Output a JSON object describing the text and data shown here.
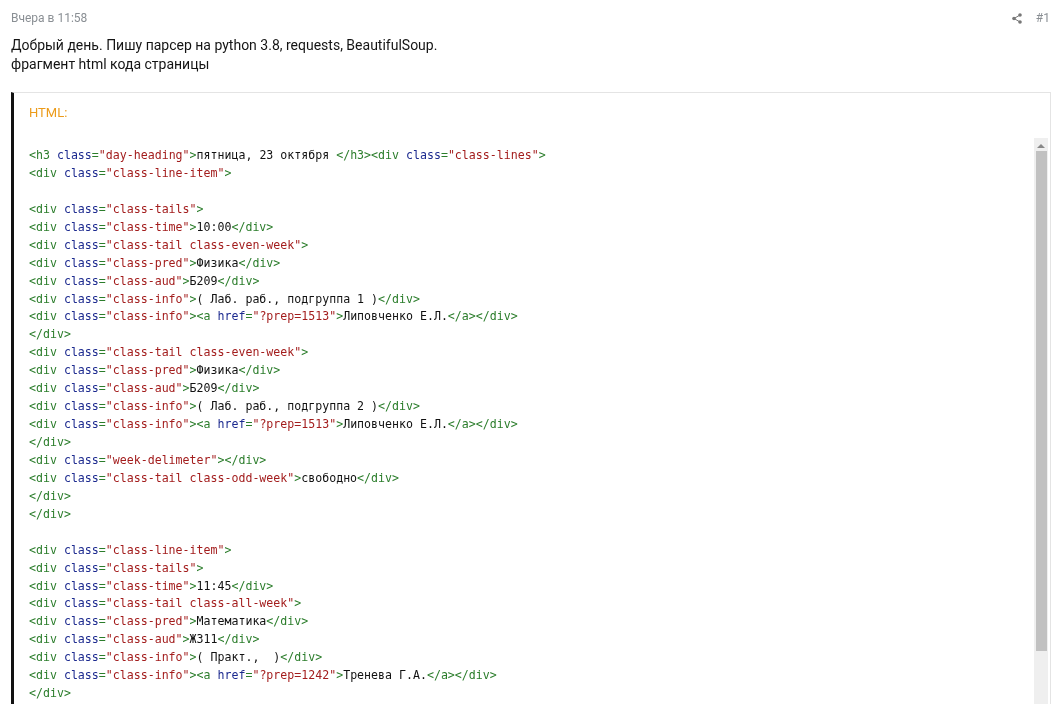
{
  "post": {
    "time": "Вчера в 11:58",
    "number": "#1",
    "body": [
      "Добрый день. Пишу парсер на python 3.8, requests, BeautifulSoup.",
      "фрагмент html кода страницы"
    ]
  },
  "code_block": {
    "language": "HTML:",
    "lines": [
      {
        "kind": "code",
        "tokens": [
          {
            "kind": "tag",
            "text": "<h3"
          },
          {
            "kind": "attr",
            "text": " class"
          },
          {
            "kind": "tag",
            "text": "="
          },
          {
            "kind": "value",
            "text": "\"day-heading\""
          },
          {
            "kind": "tag",
            "text": ">"
          },
          {
            "kind": "text",
            "text": "пятница, 23 октября "
          },
          {
            "kind": "tag",
            "text": "</h3><div"
          },
          {
            "kind": "attr",
            "text": " class"
          },
          {
            "kind": "tag",
            "text": "="
          },
          {
            "kind": "value",
            "text": "\"class-lines\""
          },
          {
            "kind": "tag",
            "text": ">"
          }
        ]
      },
      {
        "kind": "code",
        "tokens": [
          {
            "kind": "tag",
            "text": "<div"
          },
          {
            "kind": "attr",
            "text": " class"
          },
          {
            "kind": "tag",
            "text": "="
          },
          {
            "kind": "value",
            "text": "\"class-line-item\""
          },
          {
            "kind": "tag",
            "text": ">"
          }
        ]
      },
      {
        "kind": "blank"
      },
      {
        "kind": "code",
        "tokens": [
          {
            "kind": "tag",
            "text": "<div"
          },
          {
            "kind": "attr",
            "text": " class"
          },
          {
            "kind": "tag",
            "text": "="
          },
          {
            "kind": "value",
            "text": "\"class-tails\""
          },
          {
            "kind": "tag",
            "text": ">"
          }
        ]
      },
      {
        "kind": "code",
        "tokens": [
          {
            "kind": "tag",
            "text": "<div"
          },
          {
            "kind": "attr",
            "text": " class"
          },
          {
            "kind": "tag",
            "text": "="
          },
          {
            "kind": "value",
            "text": "\"class-time\""
          },
          {
            "kind": "tag",
            "text": ">"
          },
          {
            "kind": "text",
            "text": "10:00"
          },
          {
            "kind": "tag",
            "text": "</div>"
          }
        ]
      },
      {
        "kind": "code",
        "tokens": [
          {
            "kind": "tag",
            "text": "<div"
          },
          {
            "kind": "attr",
            "text": " class"
          },
          {
            "kind": "tag",
            "text": "="
          },
          {
            "kind": "value",
            "text": "\"class-tail class-even-week\""
          },
          {
            "kind": "tag",
            "text": ">"
          }
        ]
      },
      {
        "kind": "code",
        "tokens": [
          {
            "kind": "tag",
            "text": "<div"
          },
          {
            "kind": "attr",
            "text": " class"
          },
          {
            "kind": "tag",
            "text": "="
          },
          {
            "kind": "value",
            "text": "\"class-pred\""
          },
          {
            "kind": "tag",
            "text": ">"
          },
          {
            "kind": "text",
            "text": "Физика"
          },
          {
            "kind": "tag",
            "text": "</div>"
          }
        ]
      },
      {
        "kind": "code",
        "tokens": [
          {
            "kind": "tag",
            "text": "<div"
          },
          {
            "kind": "attr",
            "text": " class"
          },
          {
            "kind": "tag",
            "text": "="
          },
          {
            "kind": "value",
            "text": "\"class-aud\""
          },
          {
            "kind": "tag",
            "text": ">"
          },
          {
            "kind": "text",
            "text": "Б209"
          },
          {
            "kind": "tag",
            "text": "</div>"
          }
        ]
      },
      {
        "kind": "code",
        "tokens": [
          {
            "kind": "tag",
            "text": "<div"
          },
          {
            "kind": "attr",
            "text": " class"
          },
          {
            "kind": "tag",
            "text": "="
          },
          {
            "kind": "value",
            "text": "\"class-info\""
          },
          {
            "kind": "tag",
            "text": ">"
          },
          {
            "kind": "text",
            "text": "( Лаб. раб., подгруппа 1 )"
          },
          {
            "kind": "tag",
            "text": "</div>"
          }
        ]
      },
      {
        "kind": "code",
        "tokens": [
          {
            "kind": "tag",
            "text": "<div"
          },
          {
            "kind": "attr",
            "text": " class"
          },
          {
            "kind": "tag",
            "text": "="
          },
          {
            "kind": "value",
            "text": "\"class-info\""
          },
          {
            "kind": "tag",
            "text": "><a"
          },
          {
            "kind": "attr",
            "text": " href"
          },
          {
            "kind": "tag",
            "text": "="
          },
          {
            "kind": "value",
            "text": "\"?prep=1513\""
          },
          {
            "kind": "tag",
            "text": ">"
          },
          {
            "kind": "text",
            "text": "Липовченко Е.Л."
          },
          {
            "kind": "tag",
            "text": "</a></div>"
          }
        ]
      },
      {
        "kind": "code",
        "tokens": [
          {
            "kind": "tag",
            "text": "</div>"
          }
        ]
      },
      {
        "kind": "code",
        "tokens": [
          {
            "kind": "tag",
            "text": "<div"
          },
          {
            "kind": "attr",
            "text": " class"
          },
          {
            "kind": "tag",
            "text": "="
          },
          {
            "kind": "value",
            "text": "\"class-tail class-even-week\""
          },
          {
            "kind": "tag",
            "text": ">"
          }
        ]
      },
      {
        "kind": "code",
        "tokens": [
          {
            "kind": "tag",
            "text": "<div"
          },
          {
            "kind": "attr",
            "text": " class"
          },
          {
            "kind": "tag",
            "text": "="
          },
          {
            "kind": "value",
            "text": "\"class-pred\""
          },
          {
            "kind": "tag",
            "text": ">"
          },
          {
            "kind": "text",
            "text": "Физика"
          },
          {
            "kind": "tag",
            "text": "</div>"
          }
        ]
      },
      {
        "kind": "code",
        "tokens": [
          {
            "kind": "tag",
            "text": "<div"
          },
          {
            "kind": "attr",
            "text": " class"
          },
          {
            "kind": "tag",
            "text": "="
          },
          {
            "kind": "value",
            "text": "\"class-aud\""
          },
          {
            "kind": "tag",
            "text": ">"
          },
          {
            "kind": "text",
            "text": "Б209"
          },
          {
            "kind": "tag",
            "text": "</div>"
          }
        ]
      },
      {
        "kind": "code",
        "tokens": [
          {
            "kind": "tag",
            "text": "<div"
          },
          {
            "kind": "attr",
            "text": " class"
          },
          {
            "kind": "tag",
            "text": "="
          },
          {
            "kind": "value",
            "text": "\"class-info\""
          },
          {
            "kind": "tag",
            "text": ">"
          },
          {
            "kind": "text",
            "text": "( Лаб. раб., подгруппа 2 )"
          },
          {
            "kind": "tag",
            "text": "</div>"
          }
        ]
      },
      {
        "kind": "code",
        "tokens": [
          {
            "kind": "tag",
            "text": "<div"
          },
          {
            "kind": "attr",
            "text": " class"
          },
          {
            "kind": "tag",
            "text": "="
          },
          {
            "kind": "value",
            "text": "\"class-info\""
          },
          {
            "kind": "tag",
            "text": "><a"
          },
          {
            "kind": "attr",
            "text": " href"
          },
          {
            "kind": "tag",
            "text": "="
          },
          {
            "kind": "value",
            "text": "\"?prep=1513\""
          },
          {
            "kind": "tag",
            "text": ">"
          },
          {
            "kind": "text",
            "text": "Липовченко Е.Л."
          },
          {
            "kind": "tag",
            "text": "</a></div>"
          }
        ]
      },
      {
        "kind": "code",
        "tokens": [
          {
            "kind": "tag",
            "text": "</div>"
          }
        ]
      },
      {
        "kind": "code",
        "tokens": [
          {
            "kind": "tag",
            "text": "<div"
          },
          {
            "kind": "attr",
            "text": " class"
          },
          {
            "kind": "tag",
            "text": "="
          },
          {
            "kind": "value",
            "text": "\"week-delimeter\""
          },
          {
            "kind": "tag",
            "text": "></div>"
          }
        ]
      },
      {
        "kind": "code",
        "tokens": [
          {
            "kind": "tag",
            "text": "<div"
          },
          {
            "kind": "attr",
            "text": " class"
          },
          {
            "kind": "tag",
            "text": "="
          },
          {
            "kind": "value",
            "text": "\"class-tail class-odd-week\""
          },
          {
            "kind": "tag",
            "text": ">"
          },
          {
            "kind": "text",
            "text": "свободно"
          },
          {
            "kind": "tag",
            "text": "</div>"
          }
        ]
      },
      {
        "kind": "code",
        "tokens": [
          {
            "kind": "tag",
            "text": "</div>"
          }
        ]
      },
      {
        "kind": "code",
        "tokens": [
          {
            "kind": "tag",
            "text": "</div>"
          }
        ]
      },
      {
        "kind": "blank"
      },
      {
        "kind": "code",
        "tokens": [
          {
            "kind": "tag",
            "text": "<div"
          },
          {
            "kind": "attr",
            "text": " class"
          },
          {
            "kind": "tag",
            "text": "="
          },
          {
            "kind": "value",
            "text": "\"class-line-item\""
          },
          {
            "kind": "tag",
            "text": ">"
          }
        ]
      },
      {
        "kind": "code",
        "tokens": [
          {
            "kind": "tag",
            "text": "<div"
          },
          {
            "kind": "attr",
            "text": " class"
          },
          {
            "kind": "tag",
            "text": "="
          },
          {
            "kind": "value",
            "text": "\"class-tails\""
          },
          {
            "kind": "tag",
            "text": ">"
          }
        ]
      },
      {
        "kind": "code",
        "tokens": [
          {
            "kind": "tag",
            "text": "<div"
          },
          {
            "kind": "attr",
            "text": " class"
          },
          {
            "kind": "tag",
            "text": "="
          },
          {
            "kind": "value",
            "text": "\"class-time\""
          },
          {
            "kind": "tag",
            "text": ">"
          },
          {
            "kind": "text",
            "text": "11:45"
          },
          {
            "kind": "tag",
            "text": "</div>"
          }
        ]
      },
      {
        "kind": "code",
        "tokens": [
          {
            "kind": "tag",
            "text": "<div"
          },
          {
            "kind": "attr",
            "text": " class"
          },
          {
            "kind": "tag",
            "text": "="
          },
          {
            "kind": "value",
            "text": "\"class-tail class-all-week\""
          },
          {
            "kind": "tag",
            "text": ">"
          }
        ]
      },
      {
        "kind": "code",
        "tokens": [
          {
            "kind": "tag",
            "text": "<div"
          },
          {
            "kind": "attr",
            "text": " class"
          },
          {
            "kind": "tag",
            "text": "="
          },
          {
            "kind": "value",
            "text": "\"class-pred\""
          },
          {
            "kind": "tag",
            "text": ">"
          },
          {
            "kind": "text",
            "text": "Математика"
          },
          {
            "kind": "tag",
            "text": "</div>"
          }
        ]
      },
      {
        "kind": "code",
        "tokens": [
          {
            "kind": "tag",
            "text": "<div"
          },
          {
            "kind": "attr",
            "text": " class"
          },
          {
            "kind": "tag",
            "text": "="
          },
          {
            "kind": "value",
            "text": "\"class-aud\""
          },
          {
            "kind": "tag",
            "text": ">"
          },
          {
            "kind": "text",
            "text": "Ж311"
          },
          {
            "kind": "tag",
            "text": "</div>"
          }
        ]
      },
      {
        "kind": "code",
        "tokens": [
          {
            "kind": "tag",
            "text": "<div"
          },
          {
            "kind": "attr",
            "text": " class"
          },
          {
            "kind": "tag",
            "text": "="
          },
          {
            "kind": "value",
            "text": "\"class-info\""
          },
          {
            "kind": "tag",
            "text": ">"
          },
          {
            "kind": "text",
            "text": "( Практ.,  )"
          },
          {
            "kind": "tag",
            "text": "</div>"
          }
        ]
      },
      {
        "kind": "code",
        "tokens": [
          {
            "kind": "tag",
            "text": "<div"
          },
          {
            "kind": "attr",
            "text": " class"
          },
          {
            "kind": "tag",
            "text": "="
          },
          {
            "kind": "value",
            "text": "\"class-info\""
          },
          {
            "kind": "tag",
            "text": "><a"
          },
          {
            "kind": "attr",
            "text": " href"
          },
          {
            "kind": "tag",
            "text": "="
          },
          {
            "kind": "value",
            "text": "\"?prep=1242\""
          },
          {
            "kind": "tag",
            "text": ">"
          },
          {
            "kind": "text",
            "text": "Тренева Г.А."
          },
          {
            "kind": "tag",
            "text": "</a></div>"
          }
        ]
      },
      {
        "kind": "code",
        "tokens": [
          {
            "kind": "tag",
            "text": "</div>"
          }
        ]
      }
    ]
  }
}
